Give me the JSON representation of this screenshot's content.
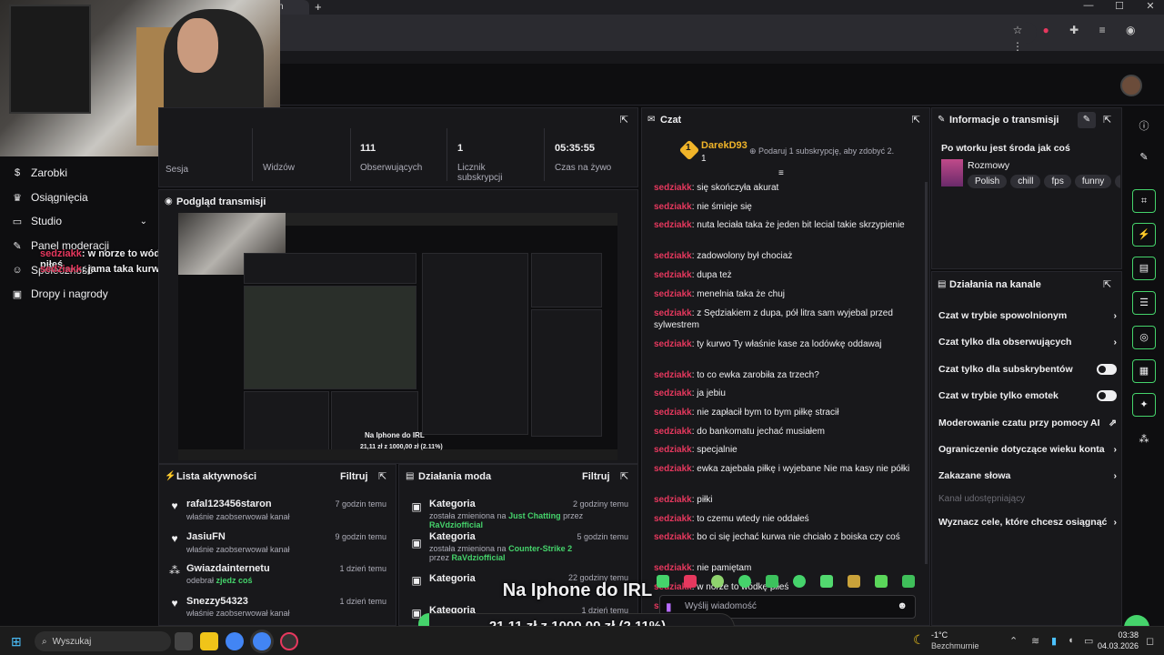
{
  "browser": {
    "new_tab": "+",
    "tab_fragment": "n",
    "minimize": "—",
    "maximize": "☐",
    "close": "✕"
  },
  "sidebar": {
    "items": [
      {
        "label": "Zarobki",
        "icon": "dollar-icon"
      },
      {
        "label": "Osiągnięcia",
        "icon": "trophy-icon"
      },
      {
        "label": "Studio",
        "icon": "studio-icon"
      },
      {
        "label": "Panel moderacji",
        "icon": "wrench-icon"
      },
      {
        "label": "Społeczność",
        "icon": "people-icon"
      },
      {
        "label": "Dropy i nagrody",
        "icon": "gift-icon"
      }
    ],
    "overlay_chat": [
      {
        "user": "sedziakk",
        "text": "w norze to wódkę piłeś"
      },
      {
        "user": "sedziakk",
        "text": "jama taka kurwa"
      }
    ]
  },
  "stats": {
    "session_label": "Sesja",
    "viewers_label": "Widzów",
    "followers_value": "111",
    "followers_label": "Obserwujących",
    "subs_value": "1",
    "subs_label": "Licznik subskrypcji",
    "uptime_value": "05:35:55",
    "uptime_label": "Czas na żywo"
  },
  "preview": {
    "title": "Podgląd transmisji"
  },
  "activity": {
    "title": "Lista aktywności",
    "filter": "Filtruj",
    "items": [
      {
        "name": "rafal123456staron",
        "action": "właśnie zaobserwował kanał",
        "time": "7 godzin temu",
        "icon": "heart-icon"
      },
      {
        "name": "JasiuFN",
        "action": "właśnie zaobserwował kanał",
        "time": "9 godzin temu",
        "icon": "heart-icon"
      },
      {
        "name": "Gwiazdainternetu",
        "action": "odebrał",
        "reward": "zjedz coś",
        "time": "1 dzień temu",
        "icon": "points-icon"
      },
      {
        "name": "Snezzy54323",
        "action": "właśnie zaobserwował kanał",
        "time": "1 dzień temu",
        "icon": "heart-icon"
      }
    ]
  },
  "modactions": {
    "title": "Działania moda",
    "filter": "Filtruj",
    "items": [
      {
        "name": "Kategoria",
        "pre": "została zmieniona na",
        "target": "Just Chatting",
        "by": "przez",
        "mod": "RaVdziofficial",
        "time": "2 godziny temu"
      },
      {
        "name": "Kategoria",
        "pre": "została zmieniona na",
        "target": "Counter-Strike 2",
        "by": "przez",
        "mod": "RaVdziofficial",
        "time": "5 godzin temu"
      },
      {
        "name": "Kategoria",
        "pre": "",
        "target": "",
        "by": "",
        "mod": "",
        "time": "22 godziny temu"
      },
      {
        "name": "Kategoria",
        "pre": "",
        "target": "",
        "by": "",
        "mod": "",
        "time": "1 dzień temu"
      }
    ]
  },
  "chat": {
    "title": "Czat",
    "top_user": "DarekD93",
    "top_count": "1",
    "sub_prompt": "Podaruj 1 subskrypcję, aby zdobyć 2.",
    "messages": [
      {
        "user": "sedziakk",
        "text": "się skończyła akurat"
      },
      {
        "user": "sedziakk",
        "text": "nie śmieje się"
      },
      {
        "user": "sedziakk",
        "text": "nuta leciała taka że jeden bit lecial takie skrzypienie"
      },
      {
        "user": "sedziakk",
        "text": "zadowolony był chociaż"
      },
      {
        "user": "sedziakk",
        "text": "dupa też"
      },
      {
        "user": "sedziakk",
        "text": "menelnia taka że chuj"
      },
      {
        "user": "sedziakk",
        "text": "z Sędziakiem z dupa, pół litra sam wyjebal przed sylwestrem"
      },
      {
        "user": "sedziakk",
        "text": "ty kurwo Ty właśnie kase za lodówkę oddawaj"
      },
      {
        "user": "sedziakk",
        "text": "to co ewka zarobiła za trzech?"
      },
      {
        "user": "sedziakk",
        "text": "ja jebiu"
      },
      {
        "user": "sedziakk",
        "text": "nie zapłacił bym to bym piłkę stracił"
      },
      {
        "user": "sedziakk",
        "text": "do bankomatu jechać musiałem"
      },
      {
        "user": "sedziakk",
        "text": "specjalnie"
      },
      {
        "user": "sedziakk",
        "text": "ewka zajebała piłkę i wyjebane Nie ma kasy nie półki"
      },
      {
        "user": "sedziakk",
        "text": "piłki"
      },
      {
        "user": "sedziakk",
        "text": "to czemu wtedy nie oddałeś"
      },
      {
        "user": "sedziakk",
        "text": "bo ci się jechać kurwa nie chciało z boiska czy coś"
      },
      {
        "user": "sedziakk",
        "text": "nie pamiętam"
      },
      {
        "user": "sedziakk",
        "text": "w norze to wódkę piłeś"
      },
      {
        "user": "sedziakk",
        "text": "jama taka kurwa"
      }
    ],
    "input_placeholder": "Wyślij wiadomość"
  },
  "info": {
    "title": "Informacje o transmisji",
    "stream_title": "Po wtorku jest środa jak coś",
    "category": "Rozmowy",
    "tags": [
      "Polish",
      "chill",
      "fps",
      "funny",
      "ga"
    ]
  },
  "channel_actions": {
    "title": "Działania na kanale",
    "rows": [
      {
        "label": "Czat w trybie spowolnionym",
        "control": "chevron"
      },
      {
        "label": "Czat tylko dla obserwujących",
        "control": "chevron"
      },
      {
        "label": "Czat tylko dla subskrybentów",
        "control": "toggle"
      },
      {
        "label": "Czat w trybie tylko emotek",
        "control": "toggle"
      },
      {
        "label": "Moderowanie czatu przy pomocy AI",
        "control": "external"
      },
      {
        "label": "Ograniczenie dotyczące wieku konta",
        "control": "chevron"
      },
      {
        "label": "Zakazane słowa",
        "control": "chevron"
      }
    ],
    "section_label": "Kanał udostępniający",
    "goal_row": "Wyznacz cele, które chcesz osiągnąć"
  },
  "overlay": {
    "title": "Na Iphone do IRL",
    "goal_text": "21,11 zł z 1000,00 zł (2.11%)",
    "goal_current": 21.11,
    "goal_target": 1000,
    "goal_fraction": 0.0211
  },
  "taskbar": {
    "search_label": "Wyszukaj",
    "weather_temp": "-1°C",
    "weather_desc": "Bezchmurnie",
    "time": "03:38",
    "date": "04.03.2026"
  },
  "colors": {
    "accent": "#45d36b",
    "username": "#e6385e",
    "panel": "#18181b",
    "background": "#0e0e10"
  }
}
